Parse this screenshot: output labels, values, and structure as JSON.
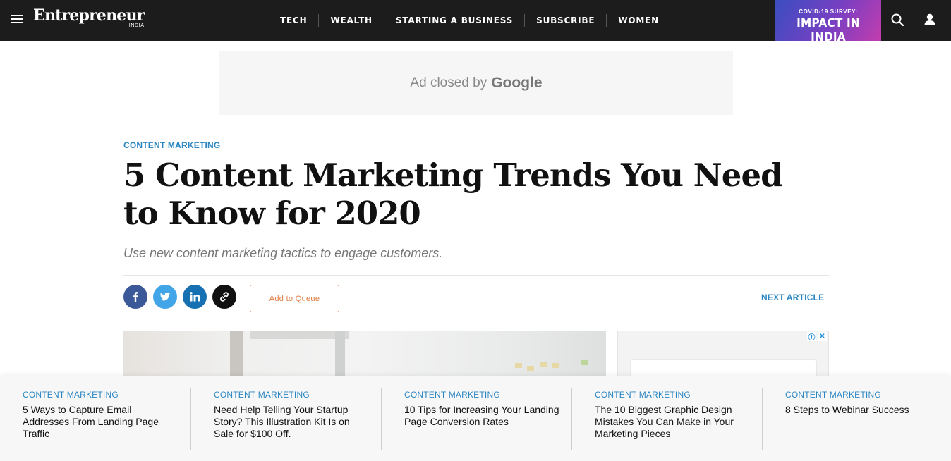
{
  "header": {
    "logo": "Entrepreneur",
    "logo_sub": "INDIA",
    "nav": [
      "TECH",
      "WEALTH",
      "STARTING A BUSINESS",
      "SUBSCRIBE",
      "WOMEN"
    ],
    "promo_top": "COVID-19 SURVEY:",
    "promo_main": "IMPACT IN INDIA"
  },
  "ad": {
    "text": "Ad closed by",
    "brand": "Google"
  },
  "article": {
    "category": "CONTENT MARKETING",
    "title": "5 Content Marketing Trends You Need to Know for 2020",
    "subtitle": "Use new content marketing tactics to engage customers.",
    "queue_label": "Add to Queue",
    "next_label": "NEXT ARTICLE"
  },
  "related": [
    {
      "category": "CONTENT MARKETING",
      "title": "5 Ways to Capture Email Addresses From Landing Page Traffic"
    },
    {
      "category": "CONTENT MARKETING",
      "title": "Need Help Telling Your Startup Story? This Illustration Kit Is on Sale for $100 Off."
    },
    {
      "category": "CONTENT MARKETING",
      "title": "10 Tips for Increasing Your Landing Page Conversion Rates"
    },
    {
      "category": "CONTENT MARKETING",
      "title": "The 10 Biggest Graphic Design Mistakes You Can Make in Your Marketing Pieces"
    },
    {
      "category": "CONTENT MARKETING",
      "title": "8 Steps to Webinar Success"
    }
  ],
  "colors": {
    "header_bg": "#1c1c1c",
    "accent_blue": "#2a86c2",
    "queue_orange": "#e07a3f",
    "facebook": "#3b5998",
    "twitter": "#42a5e8",
    "linkedin": "#1670b1"
  },
  "icons": [
    "menu-icon",
    "search-icon",
    "user-icon",
    "facebook-icon",
    "twitter-icon",
    "linkedin-icon",
    "link-icon",
    "info-icon",
    "close-icon"
  ]
}
